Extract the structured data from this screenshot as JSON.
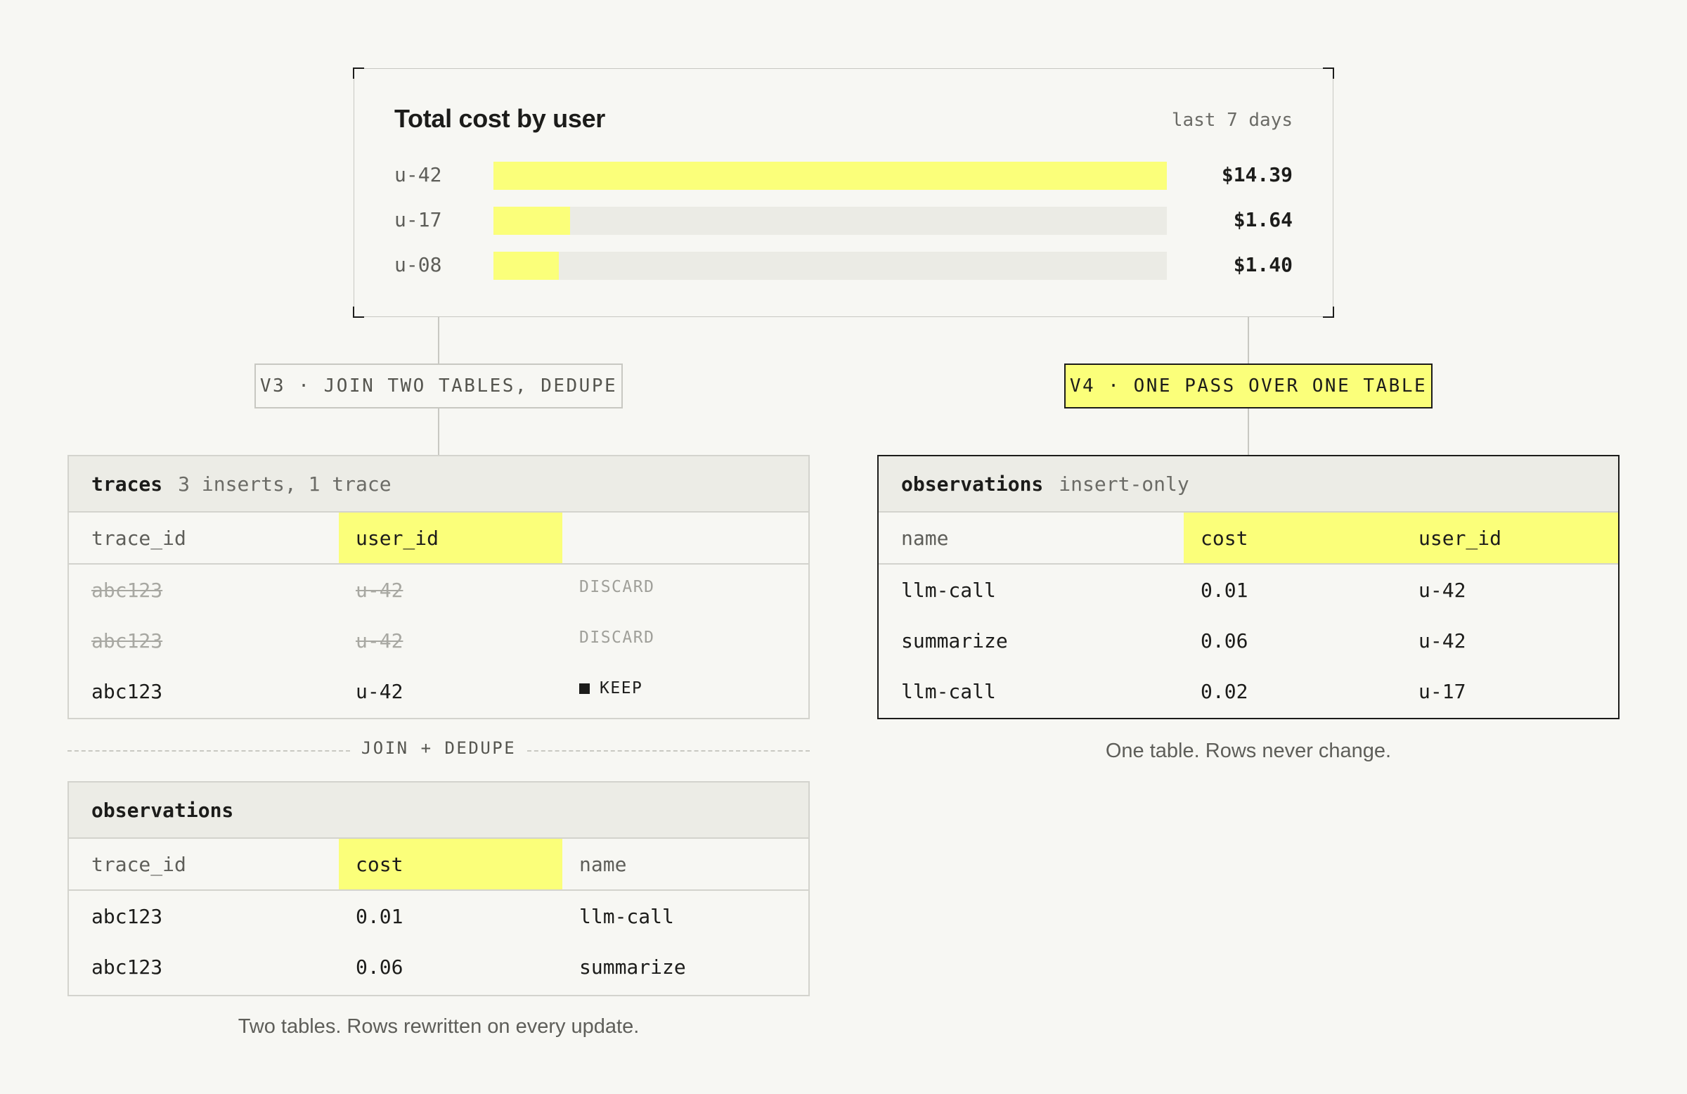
{
  "cost_card": {
    "title": "Total cost by user",
    "range": "last 7 days",
    "accent_color": "#fbff7a",
    "max_value": 14.39,
    "rows": [
      {
        "label": "u-42",
        "value": 14.39,
        "display": "$14.39"
      },
      {
        "label": "u-17",
        "value": 1.64,
        "display": "$1.64"
      },
      {
        "label": "u-08",
        "value": 1.4,
        "display": "$1.40"
      }
    ]
  },
  "v3": {
    "tag": "V3 · JOIN TWO TABLES, DEDUPE",
    "traces": {
      "name": "traces",
      "meta": "3 inserts, 1 trace",
      "columns": [
        "trace_id",
        "user_id",
        ""
      ],
      "rows": [
        {
          "trace_id": "abc123",
          "user_id": "u-42",
          "status": "DISCARD",
          "struck": true
        },
        {
          "trace_id": "abc123",
          "user_id": "u-42",
          "status": "DISCARD",
          "struck": true
        },
        {
          "trace_id": "abc123",
          "user_id": "u-42",
          "status": "KEEP",
          "struck": false
        }
      ]
    },
    "divider": "JOIN + DEDUPE",
    "observations": {
      "name": "observations",
      "columns": [
        "trace_id",
        "cost",
        "name"
      ],
      "rows": [
        {
          "trace_id": "abc123",
          "cost": "0.01",
          "name": "llm-call"
        },
        {
          "trace_id": "abc123",
          "cost": "0.06",
          "name": "summarize"
        }
      ]
    },
    "caption": "Two tables. Rows rewritten on every update."
  },
  "v4": {
    "tag": "V4 · ONE PASS OVER ONE TABLE",
    "observations": {
      "name": "observations",
      "meta": "insert-only",
      "columns": [
        "name",
        "cost",
        "user_id"
      ],
      "rows": [
        {
          "name": "llm-call",
          "cost": "0.01",
          "user_id": "u-42"
        },
        {
          "name": "summarize",
          "cost": "0.06",
          "user_id": "u-42"
        },
        {
          "name": "llm-call",
          "cost": "0.02",
          "user_id": "u-17"
        }
      ]
    },
    "caption": "One table. Rows never change."
  }
}
